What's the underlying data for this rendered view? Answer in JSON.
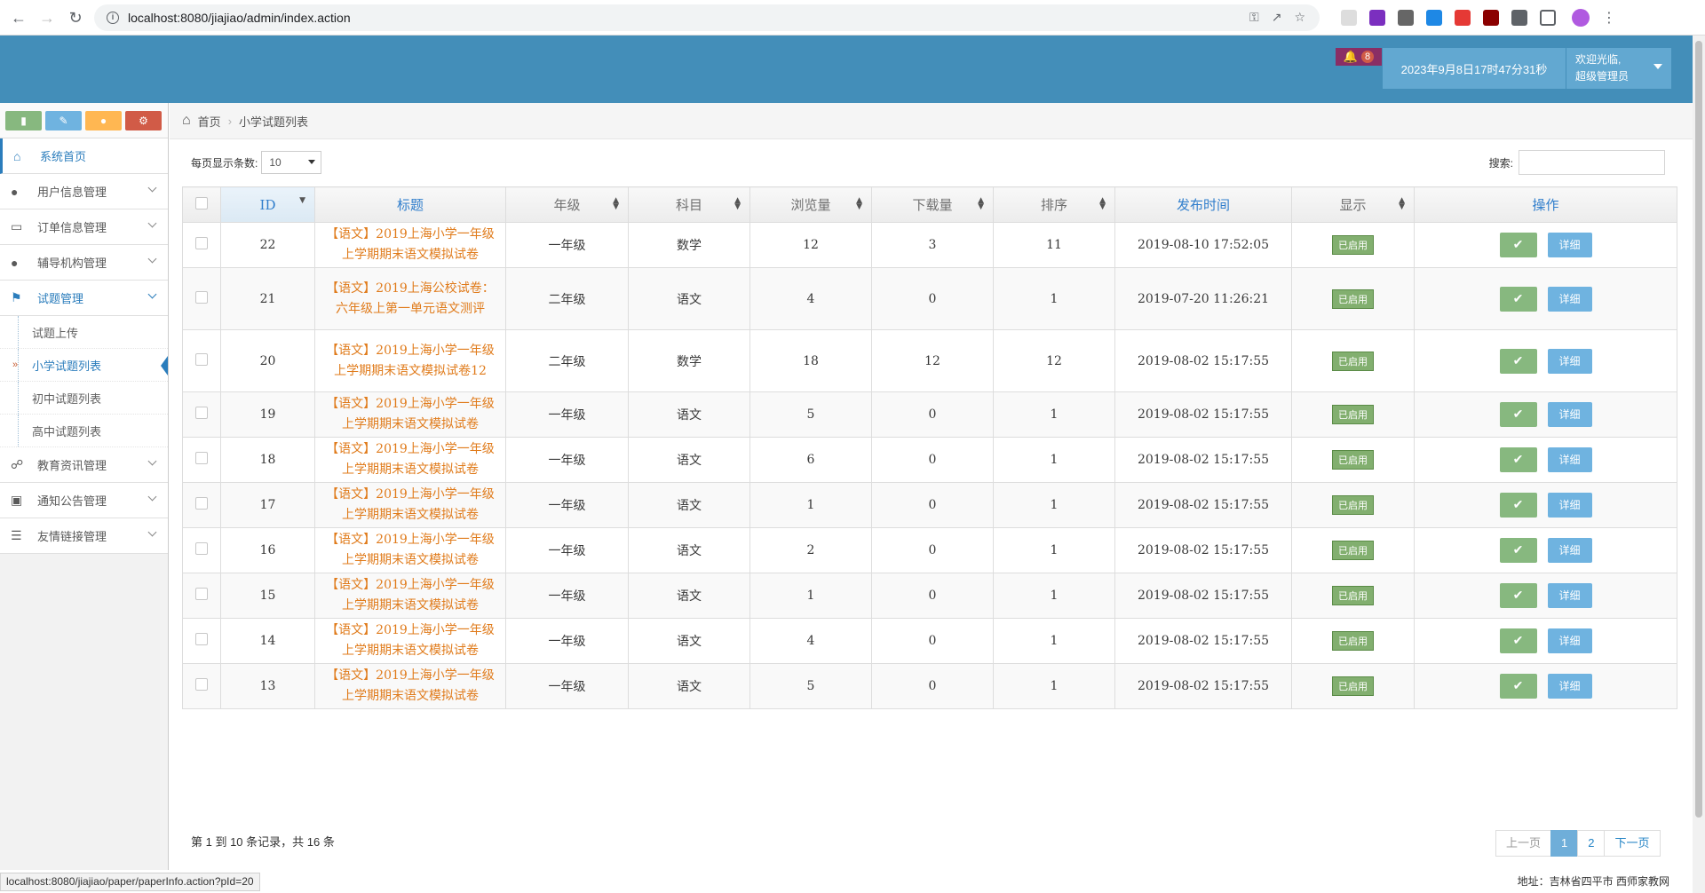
{
  "browser": {
    "url": "localhost:8080/jiajiao/admin/index.action"
  },
  "header": {
    "notification_count": "8",
    "datetime": "2023年9月8日17时47分31秒",
    "welcome": "欢迎光临,",
    "role": "超级管理员"
  },
  "sidebar": {
    "items": [
      {
        "label": "系统首页",
        "icon": "home-icon"
      },
      {
        "label": "用户信息管理",
        "icon": "user-icon"
      },
      {
        "label": "订单信息管理",
        "icon": "credit-card-icon"
      },
      {
        "label": "辅导机构管理",
        "icon": "user-icon"
      },
      {
        "label": "试题管理",
        "icon": "bookmark-icon"
      },
      {
        "label": "教育资讯管理",
        "icon": "comments-icon"
      },
      {
        "label": "通知公告管理",
        "icon": "desktop-icon"
      },
      {
        "label": "友情链接管理",
        "icon": "list-icon"
      }
    ],
    "subitems": [
      "试题上传",
      "小学试题列表",
      "初中试题列表",
      "高中试题列表"
    ]
  },
  "breadcrumb": {
    "home": "首页",
    "current": "小学试题列表"
  },
  "controls": {
    "pagesize_label": "每页显示条数:",
    "pagesize_value": "10",
    "search_label": "搜索:"
  },
  "table": {
    "headers": [
      "ID",
      "标题",
      "年级",
      "科目",
      "浏览量",
      "下载量",
      "排序",
      "发布时间",
      "显示",
      "操作"
    ],
    "status_label": "已启用",
    "detail_label": "详细",
    "rows": [
      {
        "id": "22",
        "title": "【语文】2019上海小学一年级上学期期末语文模拟试卷",
        "grade": "一年级",
        "subject": "数学",
        "views": "12",
        "downloads": "3",
        "order": "11",
        "time": "2019-08-10 17:52:05"
      },
      {
        "id": "21",
        "title": "【语文】2019上海公校试卷：六年级上第一单元语文测评",
        "grade": "二年级",
        "subject": "语文",
        "views": "4",
        "downloads": "0",
        "order": "1",
        "time": "2019-07-20 11:26:21"
      },
      {
        "id": "20",
        "title": "【语文】2019上海小学一年级上学期期末语文模拟试卷12",
        "grade": "二年级",
        "subject": "数学",
        "views": "18",
        "downloads": "12",
        "order": "12",
        "time": "2019-08-02 15:17:55"
      },
      {
        "id": "19",
        "title": "【语文】2019上海小学一年级上学期期末语文模拟试卷",
        "grade": "一年级",
        "subject": "语文",
        "views": "5",
        "downloads": "0",
        "order": "1",
        "time": "2019-08-02 15:17:55"
      },
      {
        "id": "18",
        "title": "【语文】2019上海小学一年级上学期期末语文模拟试卷",
        "grade": "一年级",
        "subject": "语文",
        "views": "6",
        "downloads": "0",
        "order": "1",
        "time": "2019-08-02 15:17:55"
      },
      {
        "id": "17",
        "title": "【语文】2019上海小学一年级上学期期末语文模拟试卷",
        "grade": "一年级",
        "subject": "语文",
        "views": "1",
        "downloads": "0",
        "order": "1",
        "time": "2019-08-02 15:17:55"
      },
      {
        "id": "16",
        "title": "【语文】2019上海小学一年级上学期期末语文模拟试卷",
        "grade": "一年级",
        "subject": "语文",
        "views": "2",
        "downloads": "0",
        "order": "1",
        "time": "2019-08-02 15:17:55"
      },
      {
        "id": "15",
        "title": "【语文】2019上海小学一年级上学期期末语文模拟试卷",
        "grade": "一年级",
        "subject": "语文",
        "views": "1",
        "downloads": "0",
        "order": "1",
        "time": "2019-08-02 15:17:55"
      },
      {
        "id": "14",
        "title": "【语文】2019上海小学一年级上学期期末语文模拟试卷",
        "grade": "一年级",
        "subject": "语文",
        "views": "4",
        "downloads": "0",
        "order": "1",
        "time": "2019-08-02 15:17:55"
      },
      {
        "id": "13",
        "title": "【语文】2019上海小学一年级上学期期末语文模拟试卷",
        "grade": "一年级",
        "subject": "语文",
        "views": "5",
        "downloads": "0",
        "order": "1",
        "time": "2019-08-02 15:17:55"
      }
    ]
  },
  "footer": {
    "info": "第 1 到 10 条记录，共 16 条",
    "prev": "上一页",
    "pages": [
      "1",
      "2"
    ],
    "next": "下一页",
    "status_url": "localhost:8080/jiajiao/paper/paperInfo.action?pId=20",
    "address": "地址：吉林省四平市   西师家教网"
  },
  "colors": {
    "header": "#438eb9",
    "accent": "#2b7dbc",
    "title_link": "#e07b1b",
    "badge": "#82af6f"
  }
}
